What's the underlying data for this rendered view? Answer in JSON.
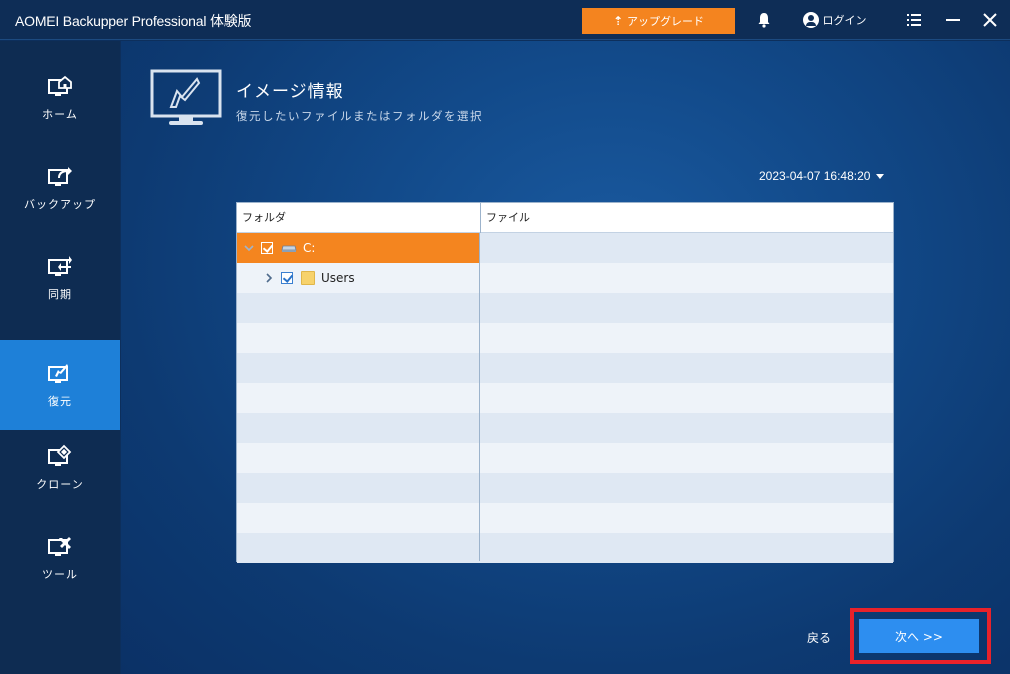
{
  "titlebar": {
    "app_title": "AOMEI Backupper Professional 体験版",
    "upgrade_label": "アップグレード",
    "login_label": "ログイン"
  },
  "sidebar": {
    "items": [
      {
        "label": "ホーム",
        "icon": "home-icon"
      },
      {
        "label": "バックアップ",
        "icon": "backup-icon"
      },
      {
        "label": "同期",
        "icon": "sync-icon"
      },
      {
        "label": "復元",
        "icon": "restore-icon",
        "active": true
      },
      {
        "label": "クローン",
        "icon": "clone-icon"
      },
      {
        "label": "ツール",
        "icon": "tools-icon"
      }
    ]
  },
  "main": {
    "title": "イメージ情報",
    "subtitle": "復元したいファイルまたはフォルダを選択",
    "datetime": "2023-04-07 16:48:20",
    "table": {
      "headers": {
        "folder": "フォルダ",
        "file": "ファイル"
      },
      "rows": [
        {
          "label": "C:",
          "type": "drive",
          "expanded": true,
          "checked": true,
          "selected": true
        },
        {
          "label": "Users",
          "type": "folder",
          "expanded": false,
          "checked": true,
          "selected": false
        }
      ]
    },
    "back_label": "戻る",
    "next_label": "次へ >>"
  },
  "colors": {
    "accent_orange": "#f4841f",
    "accent_blue": "#2d8ef0",
    "sidebar_active": "#1e80d8",
    "highlight_red": "#e8222a"
  }
}
